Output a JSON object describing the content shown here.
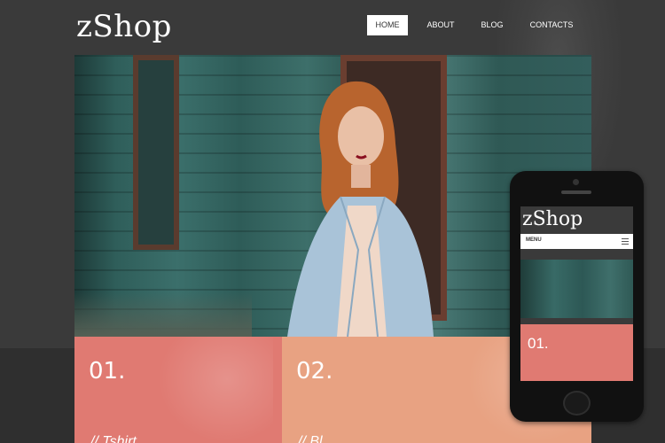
{
  "header": {
    "logo": "zShop",
    "nav": [
      {
        "label": "HOME",
        "active": true
      },
      {
        "label": "ABOUT",
        "active": false
      },
      {
        "label": "BLOG",
        "active": false
      },
      {
        "label": "CONTACTS",
        "active": false
      }
    ]
  },
  "tiles": [
    {
      "number": "01.",
      "title": "// Tshirt",
      "color": "#e07a72"
    },
    {
      "number": "02.",
      "title": "// Bl",
      "color": "#e8a282"
    }
  ],
  "phone": {
    "logo": "zShop",
    "menu_label": "MENU",
    "tile_number": "01."
  },
  "colors": {
    "background": "#3a3a3a",
    "nav_active_bg": "#ffffff",
    "tile_red": "#e07a72",
    "tile_peach": "#e8a282"
  }
}
